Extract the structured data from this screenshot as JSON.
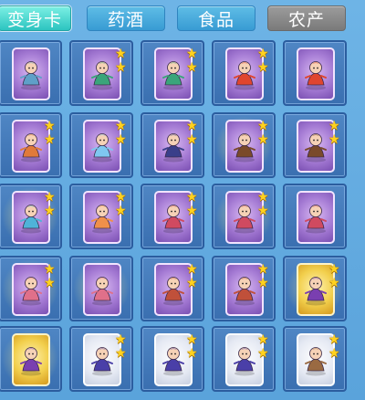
{
  "tabs": [
    {
      "label": "变身卡",
      "state": "active"
    },
    {
      "label": "药酒",
      "state": "inactive"
    },
    {
      "label": "食品",
      "state": "inactive"
    },
    {
      "label": "农产",
      "state": "gray"
    }
  ],
  "colors": {
    "star": "#ffd21f",
    "tab_active": "#2cc4c0",
    "tab_inactive": "#389bd3",
    "tab_disabled": "#7a7a7a",
    "slot": "#3a6fb0"
  },
  "cards": [
    {
      "icon": "warrior-character-icon",
      "frame": "purple",
      "stars": 0,
      "glow": false,
      "hue": "#5fa0c8"
    },
    {
      "icon": "peacock-character-icon",
      "frame": "purple",
      "stars": 2,
      "glow": false,
      "hue": "#3aa57a"
    },
    {
      "icon": "peacock-character-icon",
      "frame": "purple",
      "stars": 2,
      "glow": false,
      "hue": "#3aa57a"
    },
    {
      "icon": "lion-dance-character-icon",
      "frame": "purple",
      "stars": 2,
      "glow": false,
      "hue": "#e0452e"
    },
    {
      "icon": "lion-dance-character-icon",
      "frame": "purple",
      "stars": 0,
      "glow": false,
      "hue": "#e0452e"
    },
    {
      "icon": "fox-spirit-character-icon",
      "frame": "purple",
      "stars": 2,
      "glow": false,
      "hue": "#e07a3a"
    },
    {
      "icon": "bunny-character-icon",
      "frame": "purple",
      "stars": 2,
      "glow": false,
      "hue": "#7fc7f0"
    },
    {
      "icon": "dark-horse-character-icon",
      "frame": "purple",
      "stars": 2,
      "glow": false,
      "hue": "#3a3f8a"
    },
    {
      "icon": "monk-warrior-character-icon",
      "frame": "purple",
      "stars": 2,
      "glow": true,
      "hue": "#7a4a2a"
    },
    {
      "icon": "monk-warrior-character-icon",
      "frame": "purple",
      "stars": 2,
      "glow": false,
      "hue": "#7a4a2a"
    },
    {
      "icon": "phoenix-character-icon",
      "frame": "purple",
      "stars": 2,
      "glow": true,
      "hue": "#4fb3d8"
    },
    {
      "icon": "fox-girl-character-icon",
      "frame": "purple",
      "stars": 2,
      "glow": false,
      "hue": "#f0904a"
    },
    {
      "icon": "bird-spirit-character-icon",
      "frame": "purple",
      "stars": 2,
      "glow": false,
      "hue": "#d04a60"
    },
    {
      "icon": "bird-spirit-character-icon",
      "frame": "purple",
      "stars": 2,
      "glow": true,
      "hue": "#d04a60"
    },
    {
      "icon": "bird-spirit-character-icon",
      "frame": "purple",
      "stars": 0,
      "glow": false,
      "hue": "#d04a60"
    },
    {
      "icon": "dancer-character-icon",
      "frame": "purple",
      "stars": 2,
      "glow": true,
      "hue": "#e0708a"
    },
    {
      "icon": "dancer-character-icon",
      "frame": "purple",
      "stars": 0,
      "glow": true,
      "hue": "#e0708a"
    },
    {
      "icon": "armored-general-character-icon",
      "frame": "purple",
      "stars": 2,
      "glow": false,
      "hue": "#c0503a"
    },
    {
      "icon": "armored-general-character-icon",
      "frame": "purple",
      "stars": 2,
      "glow": false,
      "hue": "#c0503a"
    },
    {
      "icon": "fairy-character-icon",
      "frame": "gold",
      "stars": 2,
      "glow": true,
      "hue": "#7a3fb0"
    },
    {
      "icon": "fairy-character-icon",
      "frame": "gold",
      "stars": 0,
      "glow": true,
      "hue": "#7a3fb0"
    },
    {
      "icon": "purple-knight-character-icon",
      "frame": "white",
      "stars": 2,
      "glow": false,
      "hue": "#4a3fa8"
    },
    {
      "icon": "purple-knight-character-icon",
      "frame": "white",
      "stars": 2,
      "glow": false,
      "hue": "#4a3fa8"
    },
    {
      "icon": "purple-knight-character-icon",
      "frame": "white",
      "stars": 2,
      "glow": false,
      "hue": "#4a3fa8"
    },
    {
      "icon": "bear-character-icon",
      "frame": "white",
      "stars": 2,
      "glow": false,
      "hue": "#9a6a42"
    }
  ]
}
